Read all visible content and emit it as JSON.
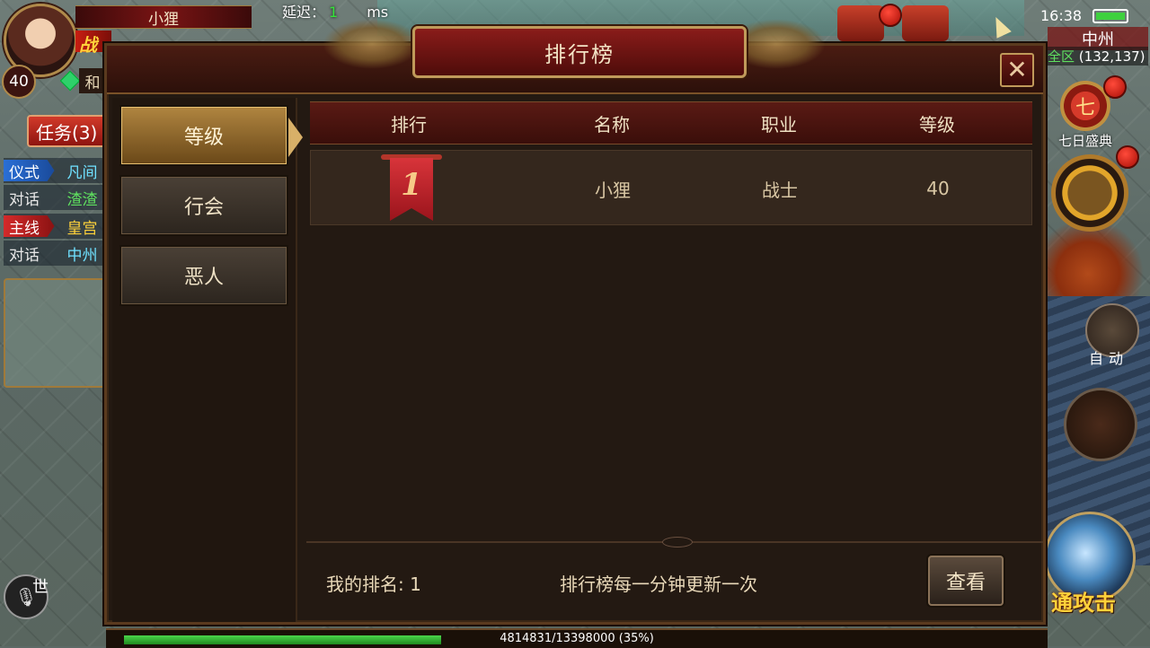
{
  "hud": {
    "player_name": "小狸",
    "level": "40",
    "hp_glyph": "战",
    "latency_label": "延迟：",
    "latency_value": "1",
    "latency_unit": "ms",
    "pk_mode": "和",
    "quest_button": "任务(3)",
    "quests": [
      {
        "tag": "仪式",
        "text": "凡间"
      },
      {
        "tag": "对话",
        "text": "渣渣"
      },
      {
        "tag": "主线",
        "text": "皇宫"
      },
      {
        "tag": "对话",
        "text": "中州"
      }
    ],
    "chat_tag": "世",
    "time": "16:38",
    "map_name": "中州",
    "zone": "全区",
    "coords": "(132,137)",
    "seven_day_label": "七日盛典",
    "seven_day_glyph": "七",
    "auto_label": "自动",
    "attack_label": "通攻击",
    "exp_text": "4814831/13398000 (35%)",
    "exp_fraction": 0.35
  },
  "dialog": {
    "title": "排行榜",
    "close_icon": "✕",
    "tabs": [
      "等级",
      "行会",
      "恶人"
    ],
    "active_tab": 0,
    "columns": [
      "排行",
      "名称",
      "职业",
      "等级"
    ],
    "rows": [
      {
        "rank": "1",
        "name": "小狸",
        "class": "战士",
        "level": "40"
      }
    ],
    "my_rank": "我的排名: 1",
    "notice": "排行榜每一分钟更新一次",
    "view_button": "查看"
  },
  "colors": {
    "panel_bg": "#231912",
    "title_red": "#8a1c1a",
    "active_tab_gold": "#b08540",
    "ribbon_red": "#d8343a",
    "exp_green": "#4ad44a"
  }
}
